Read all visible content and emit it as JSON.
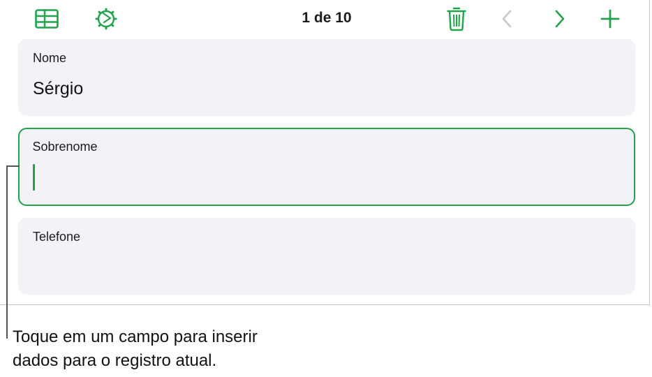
{
  "toolbar": {
    "record_counter": "1 de 10",
    "icons": [
      "table-view-icon",
      "settings-icon",
      "trash-icon",
      "chevron-left-icon",
      "chevron-right-icon",
      "plus-icon"
    ]
  },
  "fields": [
    {
      "label": "Nome",
      "value": "Sérgio"
    },
    {
      "label": "Sobrenome",
      "value": ""
    },
    {
      "label": "Telefone",
      "value": ""
    }
  ],
  "callout": {
    "line1": "Toque em um campo para inserir",
    "line2": "dados para o registro atual."
  },
  "colors": {
    "accent": "#21a34d",
    "field_bg": "#f2f2f7",
    "disabled": "#c7c7cc"
  }
}
